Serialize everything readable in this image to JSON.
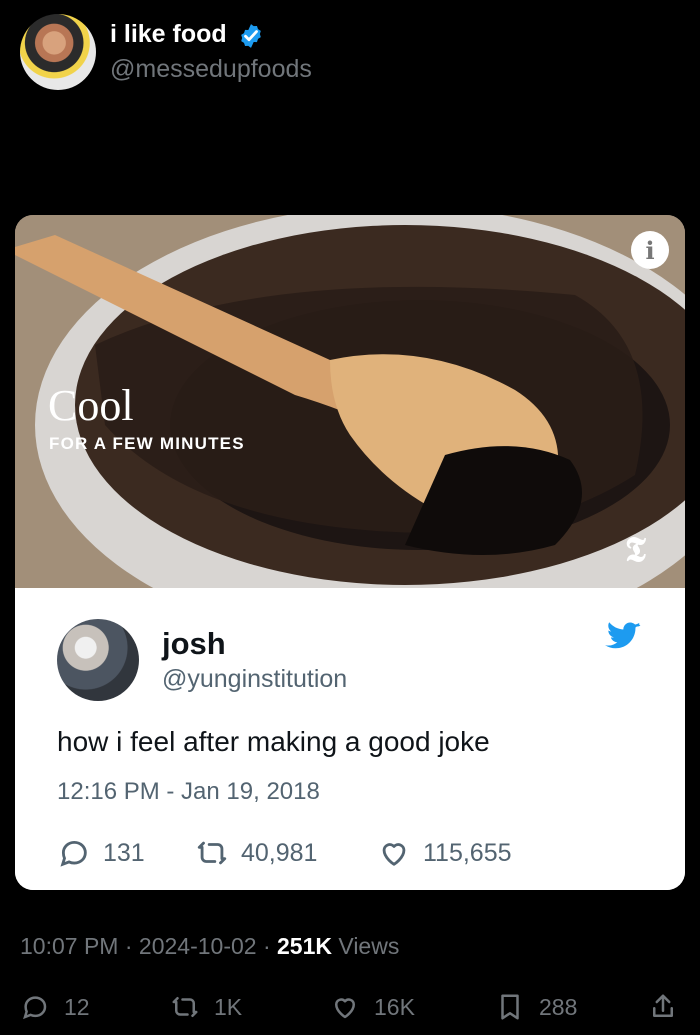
{
  "header": {
    "display_name": "i like food",
    "handle": "@messedupfoods"
  },
  "media": {
    "caption_main": "Cool",
    "caption_sub": "FOR A FEW MINUTES",
    "info_icon": "info-icon",
    "brand_icon": "nyt-icon"
  },
  "quoted_tweet": {
    "display_name": "josh",
    "handle": "@yunginstitution",
    "text": "how i feel after making a good joke",
    "timestamp": "12:16 PM - Jan 19, 2018",
    "replies": "131",
    "retweets": "40,981",
    "likes": "115,655"
  },
  "post_meta": {
    "time": "10:07 PM",
    "date": "2024-10-02",
    "views_count": "251K",
    "views_label": "Views"
  },
  "actions": {
    "replies": "12",
    "reposts": "1K",
    "likes": "16K",
    "bookmarks": "288"
  },
  "colors": {
    "background": "#000000",
    "twitter_blue": "#1d9bf0"
  }
}
